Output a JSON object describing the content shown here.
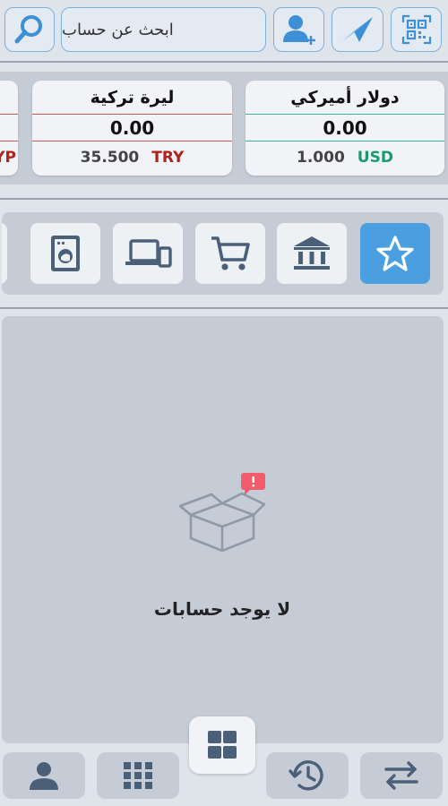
{
  "header": {
    "search_placeholder": "ابحث عن حساب",
    "icons": [
      "search-icon",
      "add-user-icon",
      "send-icon",
      "qr-code-icon"
    ]
  },
  "currencies": [
    {
      "name": "دولار أميركي",
      "amount": "0.00",
      "rate": "1.000",
      "code": "USD"
    },
    {
      "name": "ليرة تركية",
      "amount": "0.00",
      "rate": "35.500",
      "code": "TRY"
    },
    {
      "partial_code": "YP"
    }
  ],
  "categories": [
    {
      "icon": "star-icon",
      "active": true
    },
    {
      "icon": "bank-icon",
      "active": false
    },
    {
      "icon": "cart-icon",
      "active": false
    },
    {
      "icon": "devices-icon",
      "active": false
    },
    {
      "icon": "washing-machine-icon",
      "active": false
    }
  ],
  "empty_state": {
    "message": "لا يوجد حسابات",
    "icon": "empty-box-icon"
  },
  "bottom_nav": {
    "items": [
      "transfer-icon",
      "history-icon",
      "dashboard-icon",
      "apps-grid-icon",
      "profile-icon"
    ]
  },
  "colors": {
    "accent_blue": "#4a9fe0",
    "usd_green": "#1a9a6e",
    "try_red": "#b0201c",
    "panel_gray": "#c6ccd5"
  }
}
